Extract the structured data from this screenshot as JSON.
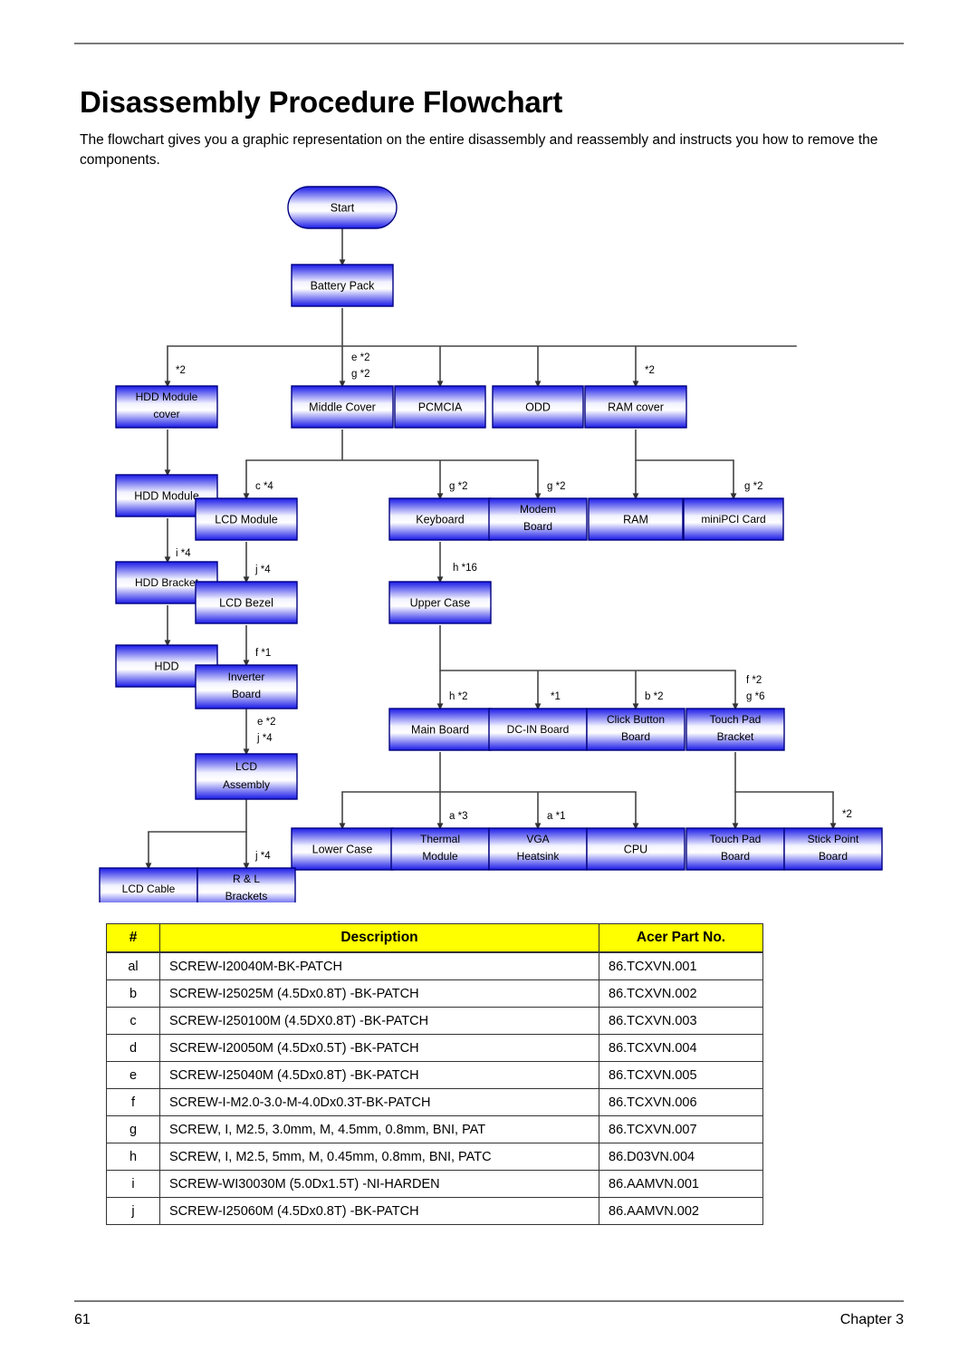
{
  "document": {
    "title": "Disassembly Procedure Flowchart",
    "intro": "The flowchart gives you a graphic representation on the entire disassembly and reassembly and instructs you how to remove the components.",
    "footer": {
      "page_number": "61",
      "chapter": "Chapter 3"
    }
  },
  "flowchart": {
    "nodes": [
      {
        "id": "start",
        "label": "Start",
        "shape": "rounded"
      },
      {
        "id": "battery_pack",
        "label": "Battery Pack"
      },
      {
        "id": "hdd_module_cover",
        "label": "HDD Module",
        "label2": "cover"
      },
      {
        "id": "middle_cover",
        "label": "Middle Cover"
      },
      {
        "id": "pcmcia",
        "label": "PCMCIA"
      },
      {
        "id": "odd",
        "label": "ODD"
      },
      {
        "id": "ram_cover",
        "label": "RAM cover"
      },
      {
        "id": "hdd_module",
        "label": "HDD Module"
      },
      {
        "id": "lcd_module",
        "label": "LCD Module"
      },
      {
        "id": "keyboard",
        "label": "Keyboard"
      },
      {
        "id": "modem_board",
        "label": "Modem",
        "label2": "Board"
      },
      {
        "id": "ram",
        "label": "RAM"
      },
      {
        "id": "minipci_card",
        "label": "miniPCI Card"
      },
      {
        "id": "hdd_bracket",
        "label": "HDD Bracket"
      },
      {
        "id": "lcd_bezel",
        "label": "LCD Bezel"
      },
      {
        "id": "upper_case",
        "label": "Upper Case"
      },
      {
        "id": "hdd",
        "label": "HDD"
      },
      {
        "id": "inverter_board",
        "label": "Inverter",
        "label2": "Board"
      },
      {
        "id": "main_board",
        "label": "Main Board"
      },
      {
        "id": "dcin_board",
        "label": "DC-IN Board"
      },
      {
        "id": "click_button",
        "label": "Click Button",
        "label2": "Board"
      },
      {
        "id": "touchpad_bracket",
        "label": "Touch Pad",
        "label2": "Bracket"
      },
      {
        "id": "lcd_assembly",
        "label": "LCD",
        "label2": "Assembly"
      },
      {
        "id": "lower_case",
        "label": "Lower Case"
      },
      {
        "id": "thermal_module",
        "label": "Thermal",
        "label2": "Module"
      },
      {
        "id": "vga_heatsink",
        "label": "VGA",
        "label2": "Heatsink"
      },
      {
        "id": "cpu",
        "label": "CPU"
      },
      {
        "id": "touchpad_board",
        "label": "Touch Pad",
        "label2": "Board"
      },
      {
        "id": "stick_point",
        "label": "Stick Point",
        "label2": "Board"
      },
      {
        "id": "lcd_cable",
        "label": "LCD Cable"
      },
      {
        "id": "rl_brackets",
        "label": "R & L",
        "label2": "Brackets"
      }
    ],
    "edge_labels": {
      "battery_to_hdd_cover": "*2",
      "battery_to_middle_1": "e *2",
      "battery_to_middle_2": "g *2",
      "battery_to_ramcover": "*2",
      "hddmodule_to_bracket": "i *4",
      "middle_to_lcdmodule": "c *4",
      "middle_to_keyboard": "g *2",
      "middle_to_modem": "g *2",
      "ramcover_to_minipci": "g *2",
      "lcdmodule_to_bezel": "j *4",
      "keyboard_to_upper": "h *16",
      "bezel_to_inverter": "f *1",
      "upper_to_mainboard": "h *2",
      "upper_to_dcin": "*1",
      "upper_to_click": "b *2",
      "upper_to_touchpad_1": "f *2",
      "upper_to_touchpad_2": "g *6",
      "inverter_to_assembly_1": "e *2",
      "inverter_to_assembly_2": "j *4",
      "main_to_thermal": "a *3",
      "main_to_vga": "a *1",
      "bracket_to_stick": "*2",
      "assembly_to_rl": "j *4"
    },
    "colors": {
      "node_fill_top": "#1414e0",
      "node_fill_mid": "#ffffff",
      "node_border": "#000080",
      "connector": "#444444"
    }
  },
  "parts_table": {
    "headers": [
      "#",
      "Description",
      "Acer Part No."
    ],
    "rows": [
      {
        "idx": "al",
        "description": "SCREW-I20040M-BK-PATCH",
        "part_no": "86.TCXVN.001"
      },
      {
        "idx": "b",
        "description": "SCREW-I25025M (4.5Dx0.8T) -BK-PATCH",
        "part_no": "86.TCXVN.002"
      },
      {
        "idx": "c",
        "description": "SCREW-I250100M (4.5DX0.8T) -BK-PATCH",
        "part_no": "86.TCXVN.003"
      },
      {
        "idx": "d",
        "description": "SCREW-I20050M (4.5Dx0.5T) -BK-PATCH",
        "part_no": "86.TCXVN.004"
      },
      {
        "idx": "e",
        "description": "SCREW-I25040M (4.5Dx0.8T) -BK-PATCH",
        "part_no": "86.TCXVN.005"
      },
      {
        "idx": "f",
        "description": "SCREW-I-M2.0-3.0-M-4.0Dx0.3T-BK-PATCH",
        "part_no": "86.TCXVN.006"
      },
      {
        "idx": "g",
        "description": "SCREW, I, M2.5, 3.0mm, M, 4.5mm, 0.8mm, BNI, PAT",
        "part_no": "86.TCXVN.007"
      },
      {
        "idx": "h",
        "description": "SCREW, I, M2.5, 5mm, M, 0.45mm, 0.8mm, BNI, PATC",
        "part_no": "86.D03VN.004"
      },
      {
        "idx": "i",
        "description": "SCREW-WI30030M (5.0Dx1.5T) -NI-HARDEN",
        "part_no": "86.AAMVN.001"
      },
      {
        "idx": "j",
        "description": "SCREW-I25060M (4.5Dx0.8T) -BK-PATCH",
        "part_no": "86.AAMVN.002"
      }
    ]
  }
}
